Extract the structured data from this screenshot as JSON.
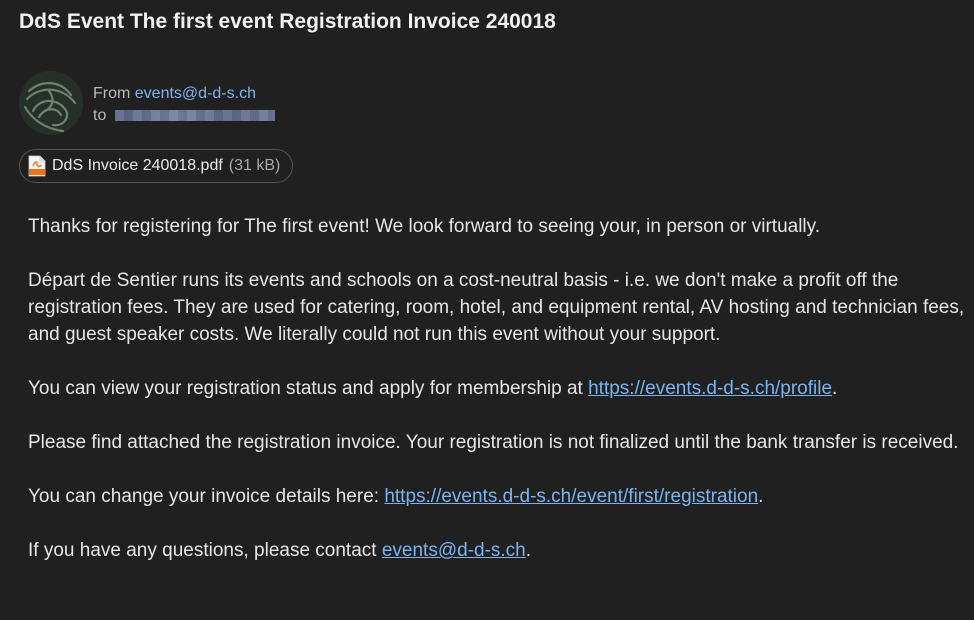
{
  "email": {
    "subject": "DdS Event The first event Registration Invoice 240018",
    "from_label": "From",
    "from_address": "events@d-d-s.ch",
    "to_label": "to"
  },
  "attachment": {
    "filename": "DdS Invoice 240018.pdf",
    "size": "(31 kB)",
    "icon": "pdf-file-icon"
  },
  "body": {
    "p1": "Thanks for registering for The first event! We look forward to seeing your, in person or virtually.",
    "p2": "Départ de Sentier runs its events and schools on a cost-neutral basis - i.e. we don't make a profit off the registration fees. They are used for catering, room, hotel, and equipment rental, AV hosting and technician fees, and guest speaker costs. We literally could not run this event without your support.",
    "p3_text": "You can view your registration status and apply for membership at ",
    "p3_link": "https://events.d-d-s.ch/profile",
    "p3_end": ".",
    "p4": "Please find attached the registration invoice. Your registration is not finalized until the bank transfer is received.",
    "p5_text": "You can change your invoice details here: ",
    "p5_link": "https://events.d-d-s.ch/event/first/registration",
    "p5_end": ".",
    "p6_text": "If you have any questions, please contact ",
    "p6_link": "events@d-d-s.ch",
    "p6_end": "."
  },
  "colors": {
    "background": "#202020",
    "link": "#78b4f0",
    "text": "#e6e6e6",
    "pdf_icon": "#e8741a"
  }
}
